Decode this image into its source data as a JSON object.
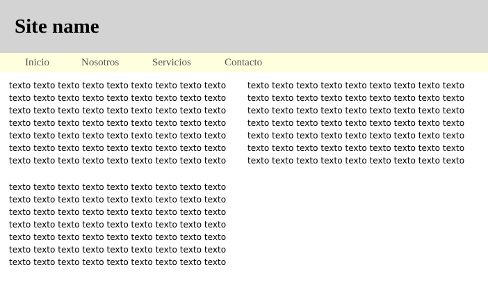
{
  "header": {
    "site_name": "Site name"
  },
  "nav": {
    "items": [
      {
        "label": "Inicio"
      },
      {
        "label": "Nosotros"
      },
      {
        "label": "Servicios"
      },
      {
        "label": "Contacto"
      }
    ]
  },
  "content": {
    "blocks": [
      {
        "lines": [
          "texto texto texto texto texto texto texto texto texto",
          "texto texto texto texto texto texto texto texto texto",
          "texto texto texto texto texto texto texto texto texto",
          "texto texto texto texto texto texto texto texto texto",
          "texto texto texto texto texto texto texto texto texto",
          "texto texto texto texto texto texto texto texto texto",
          "texto texto texto texto texto texto texto texto texto"
        ]
      },
      {
        "lines": [
          "texto texto texto texto texto texto texto texto texto",
          "texto texto texto texto texto texto texto texto texto",
          "texto texto texto texto texto texto texto texto texto",
          "texto texto texto texto texto texto texto texto texto",
          "texto texto texto texto texto texto texto texto texto",
          "texto texto texto texto texto texto texto texto texto",
          "texto texto texto texto texto texto texto texto texto"
        ]
      },
      {
        "lines": [
          "texto texto texto texto texto texto texto texto texto",
          "texto texto texto texto texto texto texto texto texto",
          "texto texto texto texto texto texto texto texto texto",
          "texto texto texto texto texto texto texto texto texto",
          "texto texto texto texto texto texto texto texto texto",
          "texto texto texto texto texto texto texto texto texto",
          "texto texto texto texto texto texto texto texto texto"
        ]
      }
    ]
  },
  "colors": {
    "header_bg": "#d3d3d3",
    "nav_bg": "#ffffde",
    "nav_text": "#555555"
  }
}
